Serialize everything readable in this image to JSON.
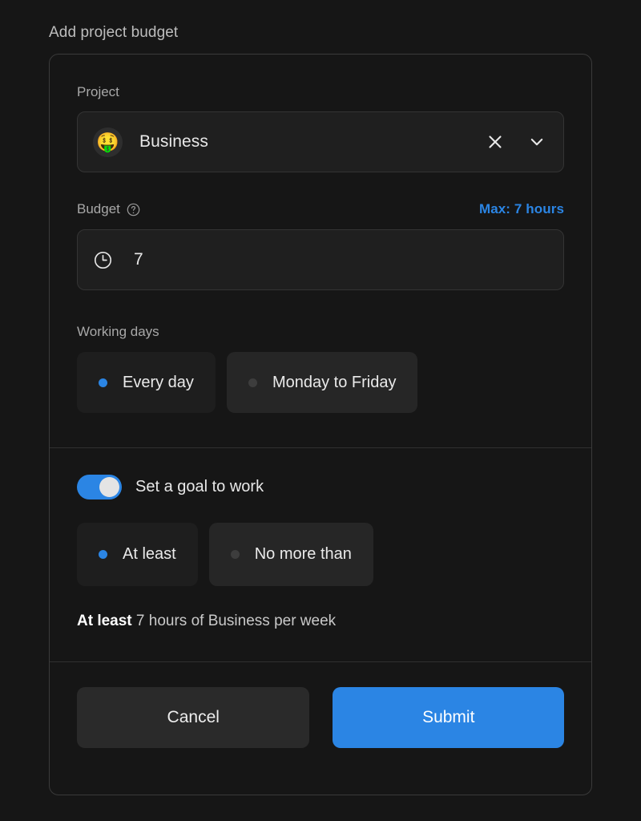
{
  "header": {
    "title": "Add project budget"
  },
  "form": {
    "project": {
      "label": "Project",
      "avatar_emoji": "🤑",
      "selected": "Business",
      "clear_icon": "close-icon",
      "expand_icon": "chevron-down-icon"
    },
    "budget": {
      "label": "Budget",
      "help_icon": "question-circle-icon",
      "max_note": "Max: 7 hours",
      "field_icon": "clock-icon",
      "value": "7",
      "placeholder": "0"
    },
    "working_days": {
      "label": "Working days",
      "options": [
        {
          "label": "Every day",
          "selected": true
        },
        {
          "label": "Monday to Friday",
          "selected": false
        }
      ]
    },
    "goal": {
      "toggle_label": "Set a goal to work",
      "toggle_on": true,
      "options": [
        {
          "label": "At least",
          "selected": true
        },
        {
          "label": "No more than",
          "selected": false
        }
      ],
      "summary_strong": "At least",
      "summary_rest": " 7 hours of Business per week"
    }
  },
  "footer": {
    "cancel_label": "Cancel",
    "submit_label": "Submit"
  },
  "colors": {
    "accent": "#2b85e4",
    "page_bg": "#161616",
    "card_border": "#3a3a3a",
    "field_bg": "#1f1f1f",
    "pill_selected_bg": "#1e1e1e",
    "pill_unselected_bg": "#262626",
    "cancel_bg": "#2a2a2a",
    "divider": "#303030"
  }
}
